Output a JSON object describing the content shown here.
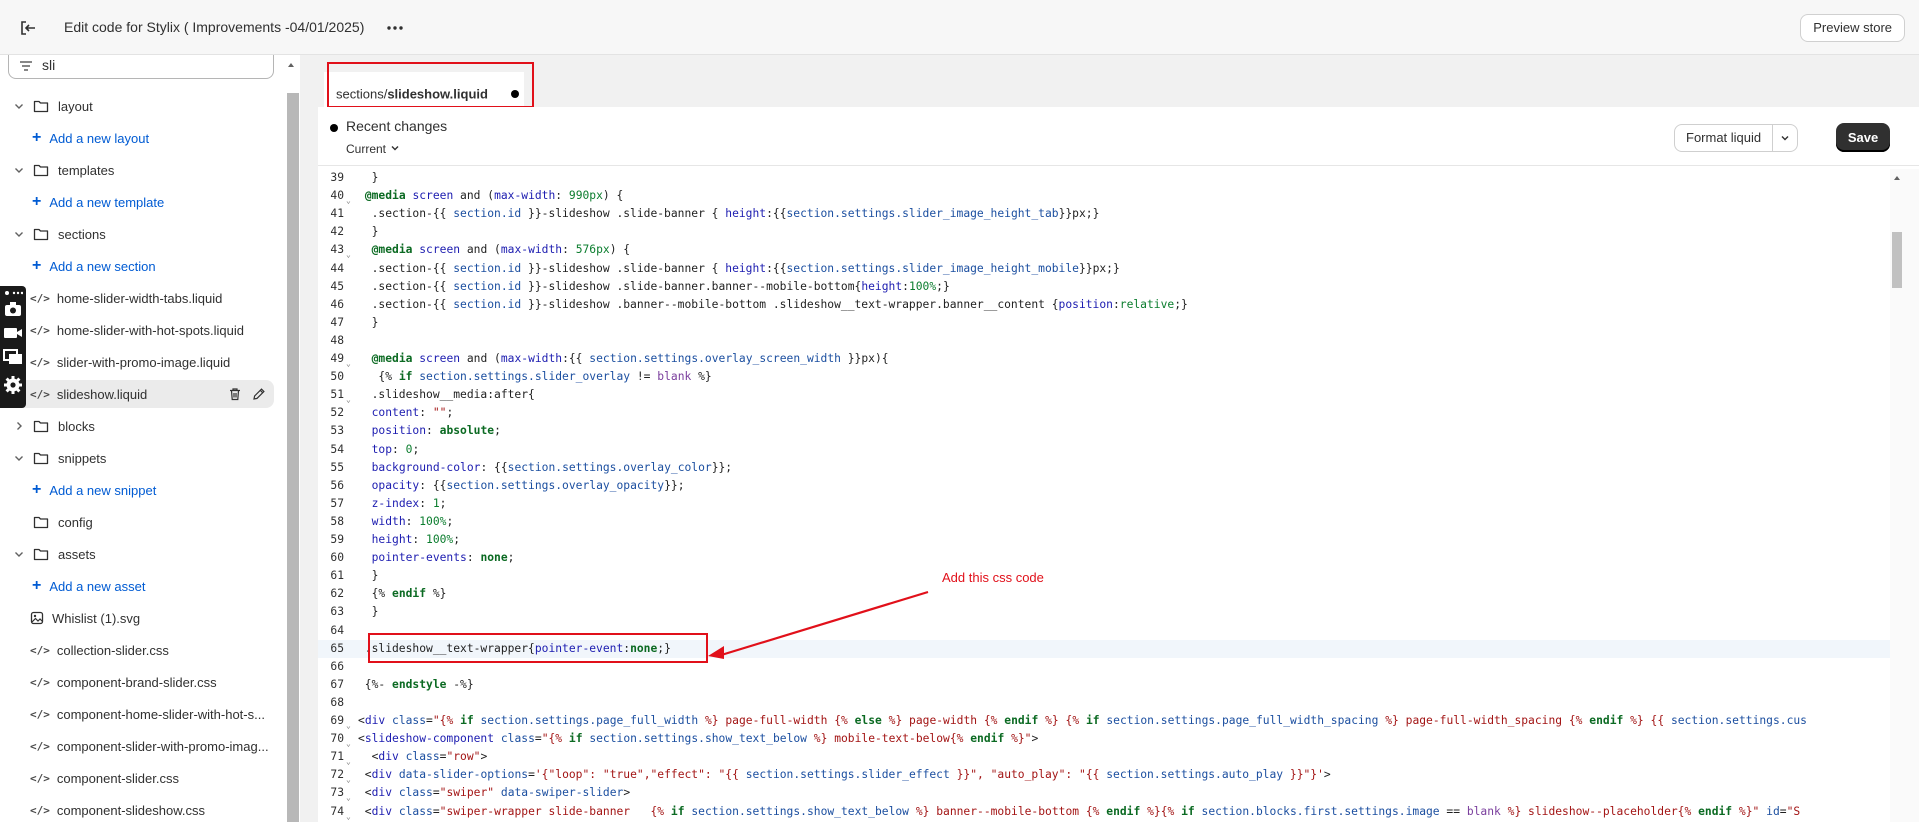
{
  "topbar": {
    "title": "Edit code for Stylix ( Improvements -04/01/2025)",
    "preview_label": "Preview store"
  },
  "sidebar": {
    "search_value": "sli",
    "items": [
      {
        "type": "folder",
        "label": "layout",
        "expanded": true
      },
      {
        "type": "add",
        "label": "Add a new layout"
      },
      {
        "type": "folder",
        "label": "templates",
        "expanded": true
      },
      {
        "type": "add",
        "label": "Add a new template"
      },
      {
        "type": "folder",
        "label": "sections",
        "expanded": true
      },
      {
        "type": "add",
        "label": "Add a new section"
      },
      {
        "type": "file",
        "label": "home-slider-width-tabs.liquid"
      },
      {
        "type": "file",
        "label": "home-slider-with-hot-spots.liquid"
      },
      {
        "type": "file",
        "label": "slider-with-promo-image.liquid"
      },
      {
        "type": "file",
        "label": "slideshow.liquid",
        "selected": true
      },
      {
        "type": "folder",
        "label": "blocks",
        "expanded": false
      },
      {
        "type": "folder",
        "label": "snippets",
        "expanded": true
      },
      {
        "type": "add",
        "label": "Add a new snippet"
      },
      {
        "type": "folder",
        "label": "config",
        "expanded": false,
        "no_chevron": true
      },
      {
        "type": "folder",
        "label": "assets",
        "expanded": true
      },
      {
        "type": "add",
        "label": "Add a new asset"
      },
      {
        "type": "file",
        "label": "Whislist (1).svg",
        "icon": "image"
      },
      {
        "type": "file",
        "label": "collection-slider.css"
      },
      {
        "type": "file",
        "label": "component-brand-slider.css"
      },
      {
        "type": "file",
        "label": "component-home-slider-with-hot-s..."
      },
      {
        "type": "file",
        "label": "component-slider-with-promo-imag..."
      },
      {
        "type": "file",
        "label": "component-slider.css"
      },
      {
        "type": "file",
        "label": "component-slideshow.css"
      }
    ]
  },
  "tab": {
    "path_prefix": "sections/",
    "file_name": "slideshow.liquid"
  },
  "editor": {
    "recent_title": "Recent changes",
    "current_label": "Current",
    "format_label": "Format liquid",
    "save_label": "Save"
  },
  "annotation": {
    "text": "Add this css code",
    "color": "#e1101a"
  },
  "code_lines": [
    {
      "n": "39",
      "html": "  }"
    },
    {
      "n": "40",
      "fold": true,
      "html": " <span class='k'>@media</span> <span class='p'>screen</span> and (<span class='p'>max-width</span>: <span class='n'>990px</span>) {"
    },
    {
      "n": "41",
      "html": "  .section-{{ <span class='v'>section.id</span> }}-slideshow .slide-banner { <span class='p'>height</span>:{{<span class='v'>section.settings.slider_image_height_tab</span>}}px;}"
    },
    {
      "n": "42",
      "html": "  }"
    },
    {
      "n": "43",
      "fold": true,
      "html": "  <span class='k'>@media</span> <span class='p'>screen</span> and (<span class='p'>max-width</span>: <span class='n'>576px</span>) {"
    },
    {
      "n": "44",
      "html": "  .section-{{ <span class='v'>section.id</span> }}-slideshow .slide-banner { <span class='p'>height</span>:{{<span class='v'>section.settings.slider_image_height_mobile</span>}}px;}"
    },
    {
      "n": "45",
      "html": "  .section-{{ <span class='v'>section.id</span> }}-slideshow .slide-banner.banner--mobile-bottom{<span class='p'>height</span>:<span class='n'>100%</span>;}"
    },
    {
      "n": "46",
      "html": "  .section-{{ <span class='v'>section.id</span> }}-slideshow .banner--mobile-bottom .slideshow__text-wrapper.banner__content {<span class='p'>position</span>:<span class='n'>relative</span>;}"
    },
    {
      "n": "47",
      "html": "  }"
    },
    {
      "n": "48",
      "html": ""
    },
    {
      "n": "49",
      "fold": true,
      "html": "  <span class='k'>@media</span> <span class='p'>screen</span> and (<span class='p'>max-width</span>:{{ <span class='v'>section.settings.overlay_screen_width</span> }}px){"
    },
    {
      "n": "50",
      "html": "   {% <span class='k'>if</span> <span class='v'>section.settings.slider_overlay</span> != <span class='m'>blank</span> %}"
    },
    {
      "n": "51",
      "fold": true,
      "html": "  .slideshow__media:after{"
    },
    {
      "n": "52",
      "html": "  <span class='p'>content</span>: <span class='s'>\"\"</span>;"
    },
    {
      "n": "53",
      "html": "  <span class='p'>position</span>: <span class='k'>absolute</span>;"
    },
    {
      "n": "54",
      "html": "  <span class='p'>top</span>: <span class='n'>0</span>;"
    },
    {
      "n": "55",
      "html": "  <span class='p'>background-color</span>: {{<span class='v'>section.settings.overlay_color</span>}};"
    },
    {
      "n": "56",
      "html": "  <span class='p'>opacity</span>: {{<span class='v'>section.settings.overlay_opacity</span>}};"
    },
    {
      "n": "57",
      "html": "  <span class='p'>z-index</span>: <span class='n'>1</span>;"
    },
    {
      "n": "58",
      "html": "  <span class='p'>width</span>: <span class='n'>100%</span>;"
    },
    {
      "n": "59",
      "html": "  <span class='p'>height</span>: <span class='n'>100%</span>;"
    },
    {
      "n": "60",
      "html": "  <span class='p'>pointer-events</span>: <span class='k'>none</span>;"
    },
    {
      "n": "61",
      "html": "  }"
    },
    {
      "n": "62",
      "html": "  {% <span class='k'>endif</span> %}"
    },
    {
      "n": "63",
      "html": "  }"
    },
    {
      "n": "64",
      "html": ""
    },
    {
      "n": "65",
      "active": true,
      "html": " .slideshow__text-wrapper{<span class='p'>pointer-event</span>:<span class='k'>none</span>;}"
    },
    {
      "n": "66",
      "html": ""
    },
    {
      "n": "67",
      "html": " {%- <span class='k'>endstyle</span> -%}"
    },
    {
      "n": "68",
      "html": ""
    },
    {
      "n": "69",
      "fold": true,
      "html": "&lt;<span class='p'>div</span> <span class='v'>class</span>=<span class='s'>\"{%</span> <span class='k'>if</span> <span class='v'>section.settings.page_full_width</span> <span class='s'>%} page-full-width {%</span> <span class='k'>else</span> <span class='s'>%} page-width {%</span> <span class='k'>endif</span> <span class='s'>%} {%</span> <span class='k'>if</span> <span class='v'>section.settings.page_full_width_spacing</span> <span class='s'>%} page-full-width_spacing {%</span> <span class='k'>endif</span> <span class='s'>%} {{</span> <span class='v'>section.settings.cus</span>"
    },
    {
      "n": "70",
      "fold": true,
      "html": "&lt;<span class='p'>slideshow-component</span> <span class='v'>class</span>=<span class='s'>\"{%</span> <span class='k'>if</span> <span class='v'>section.settings.show_text_below</span> <span class='s'>%} mobile-text-below{%</span> <span class='k'>endif</span> <span class='s'>%}\"</span>&gt;"
    },
    {
      "n": "71",
      "fold": true,
      "html": "  &lt;<span class='p'>div</span> <span class='v'>class</span>=<span class='s'>\"row\"</span>&gt;"
    },
    {
      "n": "72",
      "fold": true,
      "html": " &lt;<span class='p'>div</span> <span class='v'>data-slider-options</span>=<span class='s'>'{\"loop\": \"true\",\"effect\": \"{{</span> <span class='v'>section.settings.slider_effect</span> <span class='s'>}}\", \"auto_play\": \"{{</span> <span class='v'>section.settings.auto_play</span> <span class='s'>}}\"}'</span>&gt;"
    },
    {
      "n": "73",
      "fold": true,
      "html": " &lt;<span class='p'>div</span> <span class='v'>class</span>=<span class='s'>\"swiper\"</span> <span class='v'>data-swiper-slider</span>&gt;"
    },
    {
      "n": "74",
      "fold": true,
      "html": " &lt;<span class='p'>div</span> <span class='v'>class</span>=<span class='s'>\"swiper-wrapper slide-banner   {%</span> <span class='k'>if</span> <span class='v'>section.settings.show_text_below</span> <span class='s'>%} banner--mobile-bottom {%</span> <span class='k'>endif</span> <span class='s'>%}{%</span> <span class='k'>if</span> <span class='v'>section.blocks.first.settings.image</span> == <span class='m'>blank</span> <span class='s'>%} slideshow--placeholder{%</span> <span class='k'>endif</span> <span class='s'>%}\"</span> <span class='v'>id</span>=<span class='s'>\"S</span>"
    }
  ]
}
